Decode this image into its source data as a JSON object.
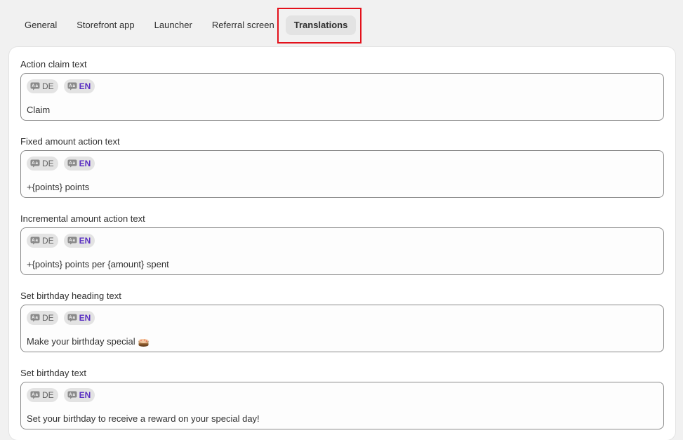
{
  "tabs": [
    {
      "label": "General"
    },
    {
      "label": "Storefront app"
    },
    {
      "label": "Launcher"
    },
    {
      "label": "Referral screen"
    },
    {
      "label": "Translations"
    }
  ],
  "active_tab": "Translations",
  "languages": {
    "de": "DE",
    "en": "EN"
  },
  "fields": [
    {
      "label": "Action claim text",
      "value": "Claim"
    },
    {
      "label": "Fixed amount action text",
      "value": "+{points} points"
    },
    {
      "label": "Incremental amount action text",
      "value": "+{points} points per {amount} spent"
    },
    {
      "label": "Set birthday heading text",
      "value": "Make your birthday special",
      "emoji": "cake"
    },
    {
      "label": "Set birthday text",
      "value": "Set your birthday to receive a reward on your special day!"
    }
  ],
  "colors": {
    "accent": "#5a2fc2",
    "highlight_border": "#e3111b"
  }
}
